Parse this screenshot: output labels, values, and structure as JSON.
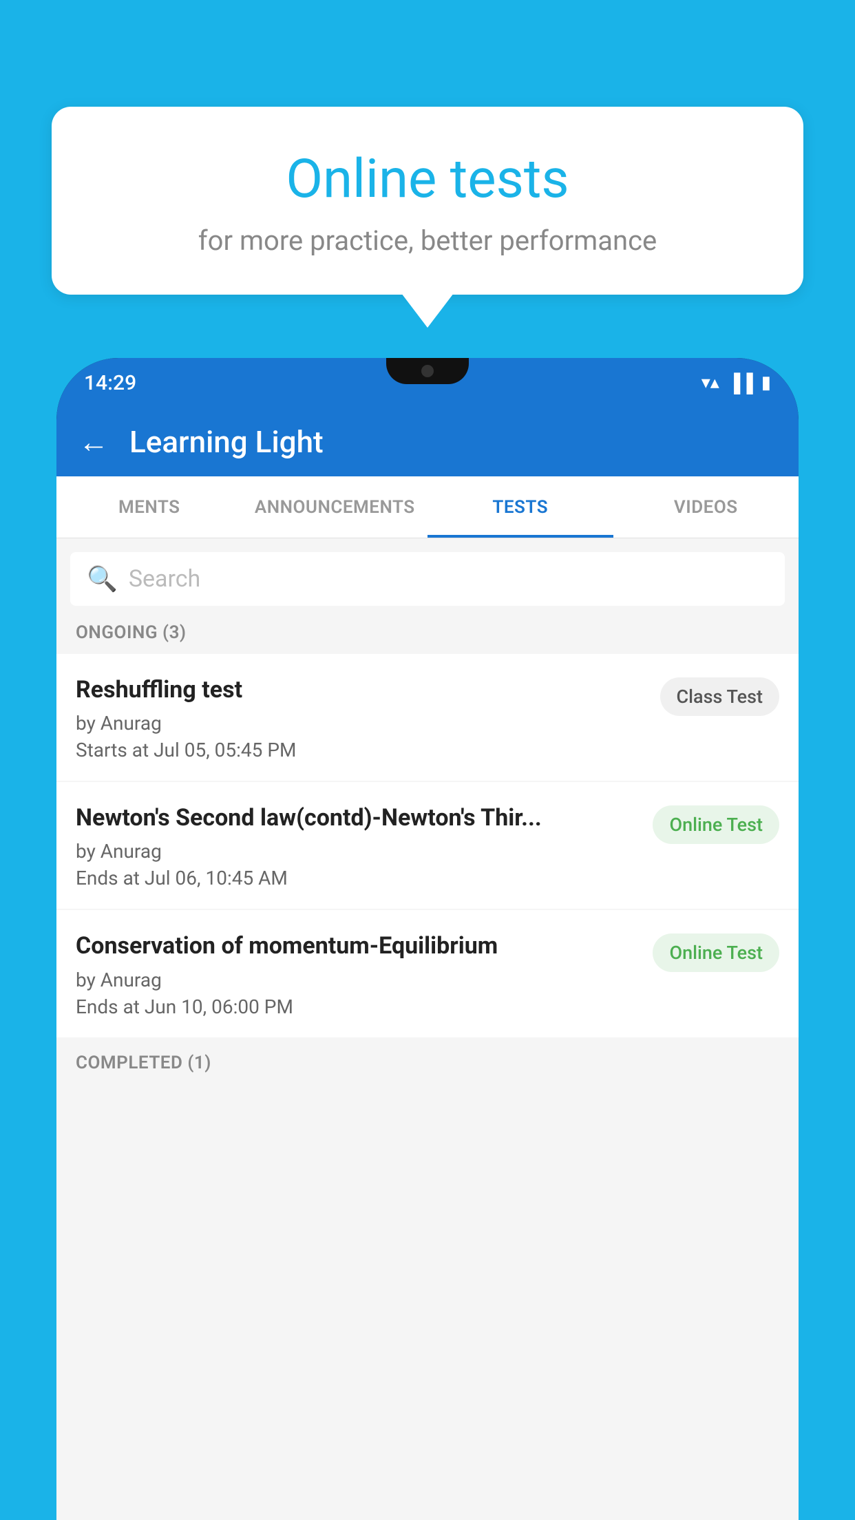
{
  "background_color": "#1ab3e8",
  "bubble": {
    "title": "Online tests",
    "subtitle": "for more practice, better performance"
  },
  "phone": {
    "status_bar": {
      "time": "14:29",
      "icons": [
        "▼",
        "◂▸",
        "▐"
      ]
    },
    "app_bar": {
      "back_label": "←",
      "title": "Learning Light"
    },
    "tabs": [
      {
        "label": "MENTS",
        "active": false
      },
      {
        "label": "ANNOUNCEMENTS",
        "active": false
      },
      {
        "label": "TESTS",
        "active": true
      },
      {
        "label": "VIDEOS",
        "active": false
      }
    ],
    "search": {
      "placeholder": "Search",
      "icon": "🔍"
    },
    "sections": [
      {
        "label": "ONGOING (3)",
        "items": [
          {
            "name": "Reshuffling test",
            "by": "by Anurag",
            "date": "Starts at  Jul 05, 05:45 PM",
            "badge": "Class Test",
            "badge_type": "class"
          },
          {
            "name": "Newton's Second law(contd)-Newton's Thir...",
            "by": "by Anurag",
            "date": "Ends at  Jul 06, 10:45 AM",
            "badge": "Online Test",
            "badge_type": "online"
          },
          {
            "name": "Conservation of momentum-Equilibrium",
            "by": "by Anurag",
            "date": "Ends at  Jun 10, 06:00 PM",
            "badge": "Online Test",
            "badge_type": "online"
          }
        ]
      },
      {
        "label": "COMPLETED (1)",
        "items": []
      }
    ]
  }
}
